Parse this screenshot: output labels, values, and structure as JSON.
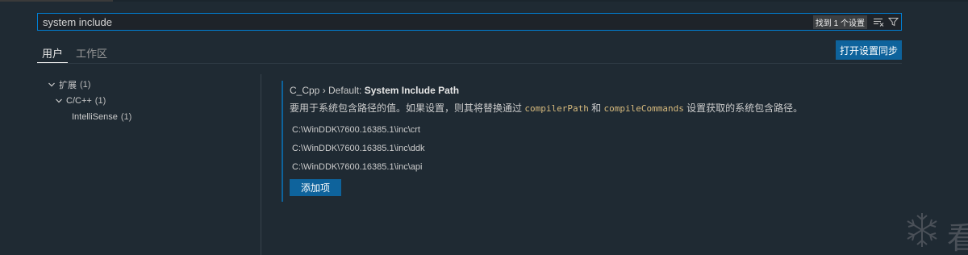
{
  "search": {
    "value": "system include",
    "result_count": "找到 1 个设置"
  },
  "tabs": [
    {
      "label": "用户",
      "active": true
    },
    {
      "label": "工作区",
      "active": false
    }
  ],
  "sync_button": {
    "label": "打开设置同步"
  },
  "tree": {
    "items": [
      {
        "label": "扩展",
        "count": "(1)",
        "expanded": true
      },
      {
        "label": "C/C++",
        "count": "(1)",
        "expanded": true
      },
      {
        "label": "IntelliSense",
        "count": "(1)"
      }
    ]
  },
  "setting": {
    "category": "C_Cpp › Default: ",
    "name": "System Include Path",
    "description": {
      "part1": "要用于系统包含路径的值。如果设置，则其将替换通过 ",
      "code1": "compilerPath",
      "part2": " 和 ",
      "code2": "compileCommands",
      "part3": " 设置获取的系统包含路径。"
    },
    "paths": [
      "C:\\WinDDK\\7600.16385.1\\inc\\crt",
      "C:\\WinDDK\\7600.16385.1\\inc\\ddk",
      "C:\\WinDDK\\7600.16385.1\\inc\\api"
    ],
    "add_button": "添加项"
  },
  "watermark": {
    "char": "看",
    "icon": "snowflake-icon"
  },
  "colors": {
    "background": "#1f2a33",
    "accent": "#0e639c",
    "focus_border": "#007fd4",
    "code": "#d7ba7d"
  }
}
